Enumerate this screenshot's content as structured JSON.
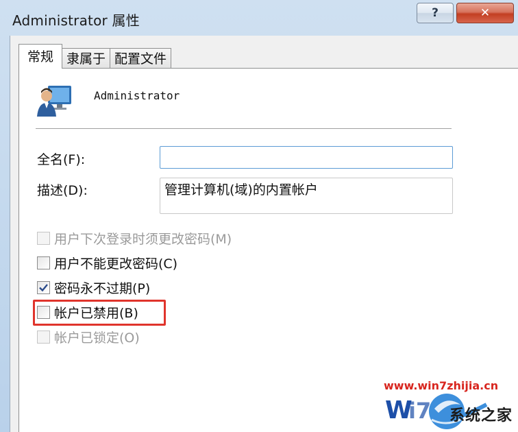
{
  "window": {
    "title": "Administrator 属性",
    "help_label": "?",
    "close_label": "✕"
  },
  "tabs": [
    {
      "label": "常规",
      "active": true
    },
    {
      "label": "隶属于",
      "active": false
    },
    {
      "label": "配置文件",
      "active": false
    }
  ],
  "general": {
    "user_icon": "user-monitor-icon",
    "username": "Administrator",
    "fullname_label": "全名(F):",
    "fullname_value": "",
    "description_label": "描述(D):",
    "description_value": "管理计算机(域)的内置帐户",
    "options": [
      {
        "label": "用户下次登录时须更改密码(M)",
        "checked": false,
        "enabled": false
      },
      {
        "label": "用户不能更改密码(C)",
        "checked": false,
        "enabled": true
      },
      {
        "label": "密码永不过期(P)",
        "checked": true,
        "enabled": true
      },
      {
        "label": "帐户已禁用(B)",
        "checked": false,
        "enabled": true
      },
      {
        "label": "帐户已锁定(O)",
        "checked": false,
        "enabled": false
      }
    ]
  },
  "watermark": {
    "url": "www.win7zhijia.cn",
    "brand": "系统之家"
  },
  "colors": {
    "highlight": "#e0342c",
    "close_button": "#c33f22",
    "input_focus": "#5b9bd5"
  }
}
